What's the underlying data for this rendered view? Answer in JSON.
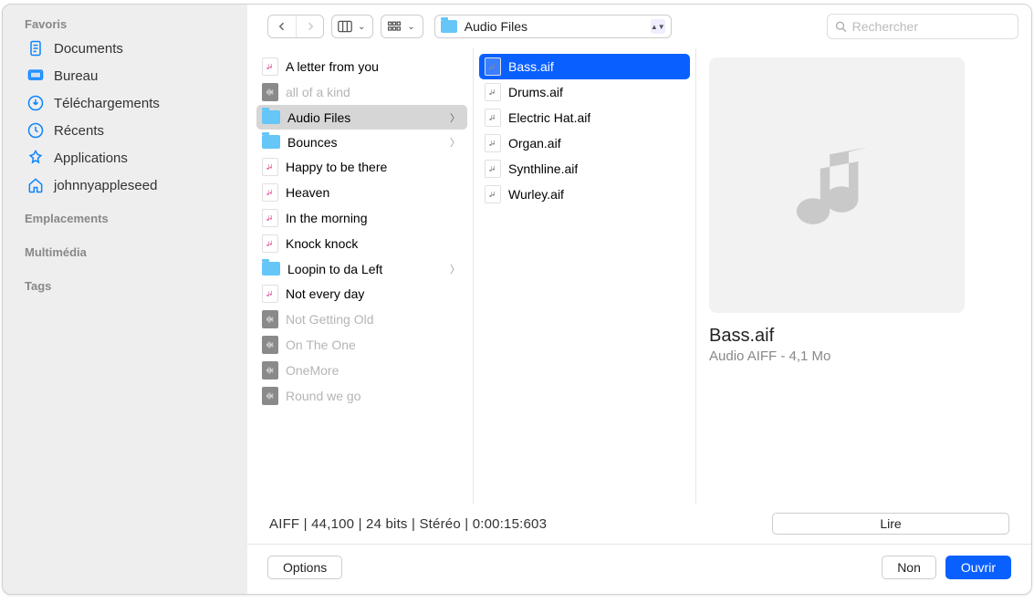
{
  "sidebar": {
    "sections": [
      {
        "title": "Favoris",
        "items": [
          {
            "label": "Documents",
            "icon": "doc"
          },
          {
            "label": "Bureau",
            "icon": "desktop"
          },
          {
            "label": "Téléchargements",
            "icon": "download"
          },
          {
            "label": "Récents",
            "icon": "clock"
          },
          {
            "label": "Applications",
            "icon": "apps"
          },
          {
            "label": "johnnyappleseed",
            "icon": "home"
          }
        ]
      },
      {
        "title": "Emplacements",
        "items": []
      },
      {
        "title": "Multimédia",
        "items": []
      },
      {
        "title": "Tags",
        "items": []
      }
    ]
  },
  "toolbar": {
    "path_label": "Audio Files",
    "search_placeholder": "Rechercher"
  },
  "columns": {
    "col1": [
      {
        "label": "A letter from you",
        "type": "music",
        "dim": false
      },
      {
        "label": "all of a kind",
        "type": "proj",
        "dim": true
      },
      {
        "label": "Audio Files",
        "type": "folder",
        "dim": false,
        "selected": true,
        "arrow": true
      },
      {
        "label": "Bounces",
        "type": "folder",
        "dim": false,
        "arrow": true
      },
      {
        "label": "Happy to be there",
        "type": "music",
        "dim": false
      },
      {
        "label": "Heaven",
        "type": "music",
        "dim": false
      },
      {
        "label": "In the morning",
        "type": "music",
        "dim": false
      },
      {
        "label": "Knock knock",
        "type": "music",
        "dim": false
      },
      {
        "label": "Loopin to da Left",
        "type": "folder",
        "dim": false,
        "arrow": true
      },
      {
        "label": "Not every day",
        "type": "music",
        "dim": false
      },
      {
        "label": "Not Getting Old",
        "type": "proj",
        "dim": true
      },
      {
        "label": "On The One",
        "type": "proj",
        "dim": true
      },
      {
        "label": "OneMore",
        "type": "proj",
        "dim": true
      },
      {
        "label": "Round we go",
        "type": "proj",
        "dim": true
      }
    ],
    "col2": [
      {
        "label": "Bass.aif",
        "type": "audio",
        "selected": true
      },
      {
        "label": "Drums.aif",
        "type": "audio"
      },
      {
        "label": "Electric Hat.aif",
        "type": "audio"
      },
      {
        "label": "Organ.aif",
        "type": "audio"
      },
      {
        "label": "Synthline.aif",
        "type": "audio"
      },
      {
        "label": "Wurley.aif",
        "type": "audio"
      }
    ]
  },
  "preview": {
    "filename": "Bass.aif",
    "meta": "Audio AIFF - 4,1 Mo"
  },
  "info": {
    "text": "AIFF  |  44,100  | 24 bits |  Stéréo  |  0:00:15:603",
    "play_label": "Lire"
  },
  "buttons": {
    "options": "Options",
    "cancel": "Non",
    "open": "Ouvrir"
  }
}
